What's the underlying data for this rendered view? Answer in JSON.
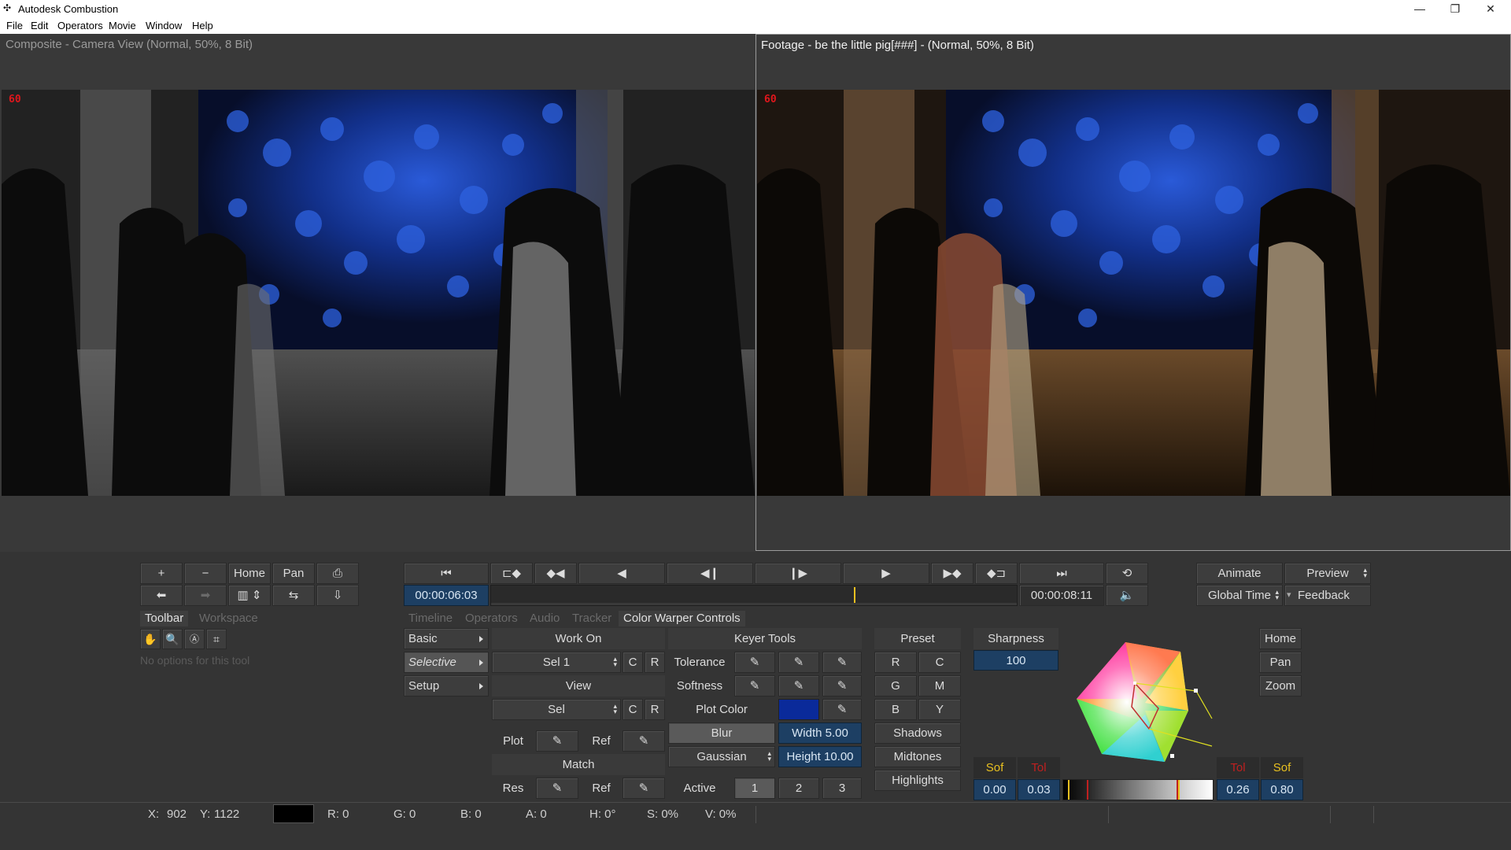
{
  "window": {
    "title": "Autodesk Combustion",
    "minimize": "—",
    "restore": "❐",
    "close": "✕"
  },
  "menu": [
    "File",
    "Edit",
    "Operators",
    "Movie",
    "Window",
    "Help"
  ],
  "viewers": {
    "left": {
      "title": "Composite - Camera View (Normal, 50%, 8 Bit)",
      "frame_badge": "60"
    },
    "right": {
      "title": "Footage - be the little pig[###] -  (Normal, 50%, 8 Bit)",
      "frame_badge": "60"
    }
  },
  "view_controls": {
    "zoom_in": "+",
    "zoom_out": "−",
    "home": "Home",
    "pan": "Pan"
  },
  "transport": {
    "current_time": "00:00:06:03",
    "end_time": "00:00:08:11",
    "progress": 0.69
  },
  "right_controls": {
    "animate": "Animate",
    "preview": "Preview",
    "global_time": "Global Time",
    "feedback": "Feedback"
  },
  "left_tabs": [
    "Toolbar",
    "Workspace"
  ],
  "left_tab_active": "Toolbar",
  "no_options_text": "No options for this tool",
  "main_tabs": [
    "Timeline",
    "Operators",
    "Audio",
    "Tracker",
    "Color Warper Controls"
  ],
  "main_tab_active": "Color Warper Controls",
  "color_warper": {
    "mode_buttons": [
      "Basic",
      "Selective",
      "Setup"
    ],
    "mode_active": "Selective",
    "work_on": {
      "header": "Work On",
      "sel": "Sel 1",
      "c": "C",
      "r": "R"
    },
    "view": {
      "header": "View",
      "sel": "Sel",
      "c": "C",
      "r": "R"
    },
    "plot_row": {
      "plot": "Plot",
      "ref": "Ref"
    },
    "match": {
      "header": "Match",
      "res": "Res",
      "ref": "Ref"
    },
    "keyer": {
      "header": "Keyer Tools",
      "tolerance": "Tolerance",
      "softness": "Softness",
      "plot_color_label": "Plot Color",
      "plot_color": "#0a2a9a",
      "blur": "Blur",
      "width": "Width 5.00",
      "gaussian": "Gaussian",
      "height": "Height 10.00",
      "active": "Active",
      "active_buttons": [
        "1",
        "2",
        "3"
      ]
    },
    "preset": {
      "header": "Preset",
      "buttons": [
        "R",
        "C",
        "G",
        "M",
        "B",
        "Y"
      ],
      "ranges": [
        "Shadows",
        "Midtones",
        "Highlights"
      ]
    },
    "sharpness": {
      "label": "Sharpness",
      "value": "100"
    },
    "wheel_buttons": [
      "Home",
      "Pan",
      "Zoom"
    ],
    "range": {
      "labels": [
        "Sof",
        "Tol",
        "Tol",
        "Sof"
      ],
      "values": [
        "0.00",
        "0.03",
        "0.26",
        "0.80"
      ]
    }
  },
  "statusbar": {
    "x_label": "X:",
    "x": "902",
    "y_label": "Y:",
    "y": "1122",
    "r": "R: 0",
    "g": "G: 0",
    "b": "B: 0",
    "a": "A: 0",
    "h": "H: 0°",
    "s": "S: 0%",
    "v": "V: 0%"
  },
  "colors": {
    "accent_blue": "#1d3f63",
    "frame_badge": "#e0161c",
    "plot_color": "#0a2a9a",
    "timeline_cursor": "#f0c020"
  }
}
